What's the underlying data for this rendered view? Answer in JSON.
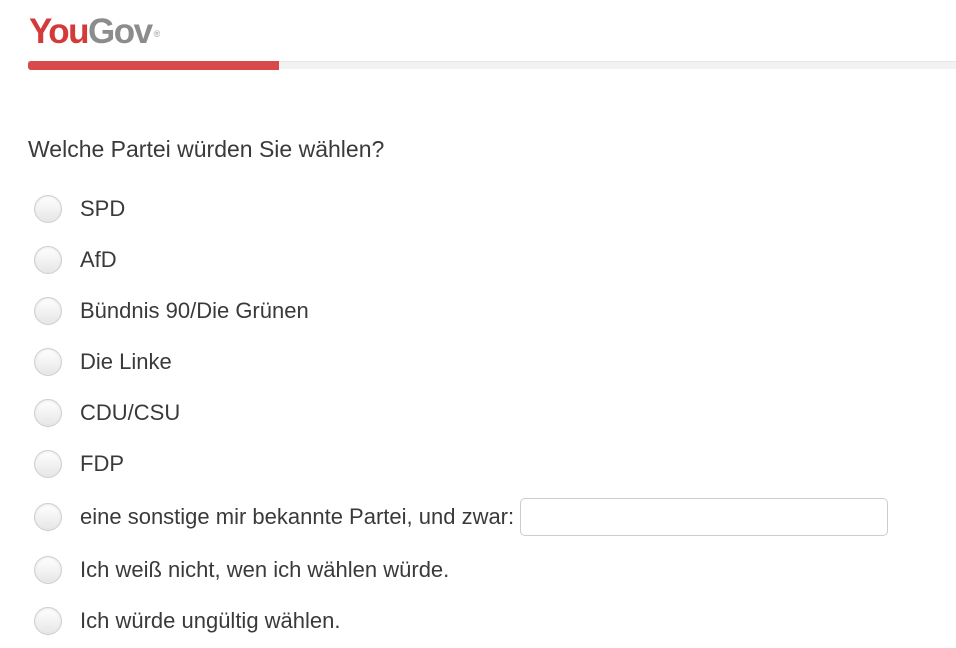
{
  "brand": {
    "logo_you": "You",
    "logo_gov": "Gov",
    "logo_mark": "®",
    "colors": {
      "you": "#d53a3a",
      "gov": "#8c8c8c"
    }
  },
  "progress": {
    "fraction": 0.27,
    "color": "#d84a4a"
  },
  "question": {
    "text": "Welche Partei würden Sie wählen?"
  },
  "options": [
    {
      "label": "SPD"
    },
    {
      "label": "AfD"
    },
    {
      "label": "Bündnis 90/Die Grünen"
    },
    {
      "label": "Die Linke"
    },
    {
      "label": "CDU/CSU"
    },
    {
      "label": "FDP"
    },
    {
      "label": "eine sonstige mir bekannte Partei, und zwar:",
      "input_value": "",
      "input_placeholder": ""
    },
    {
      "label": "Ich weiß nicht, wen ich wählen würde."
    },
    {
      "label": "Ich würde ungültig wählen."
    }
  ]
}
